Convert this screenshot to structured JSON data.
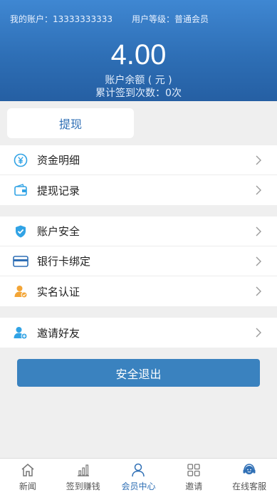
{
  "header": {
    "account_label": "我的账户：13333333333",
    "level_label": "用户等级：普通会员",
    "balance": "4.00",
    "balance_label": "账户余额 ( 元 )",
    "checkin_label": "累计签到次数：0次"
  },
  "withdraw_button": "提现",
  "menu_group_1": [
    {
      "label": "资金明细",
      "icon": "yuan-circle-icon"
    },
    {
      "label": "提现记录",
      "icon": "wallet-icon"
    }
  ],
  "menu_group_2": [
    {
      "label": "账户安全",
      "icon": "shield-check-icon"
    },
    {
      "label": "银行卡绑定",
      "icon": "bank-card-icon"
    },
    {
      "label": "实名认证",
      "icon": "user-verified-icon"
    }
  ],
  "menu_group_3": [
    {
      "label": "邀请好友",
      "icon": "user-add-icon"
    }
  ],
  "logout_button": "安全退出",
  "tabbar": [
    {
      "label": "新闻",
      "icon": "home-icon"
    },
    {
      "label": "签到赚钱",
      "icon": "bar-chart-icon"
    },
    {
      "label": "会员中心",
      "icon": "user-icon",
      "active": true
    },
    {
      "label": "邀请",
      "icon": "grid-icon"
    },
    {
      "label": "在线客服",
      "icon": "customer-service-icon"
    }
  ],
  "colors": {
    "primary": "#2f6fb5",
    "header_top": "#3f87d2",
    "logout": "#3a82bf",
    "icon_blue": "#31a3e5",
    "icon_orange": "#f3a536"
  }
}
